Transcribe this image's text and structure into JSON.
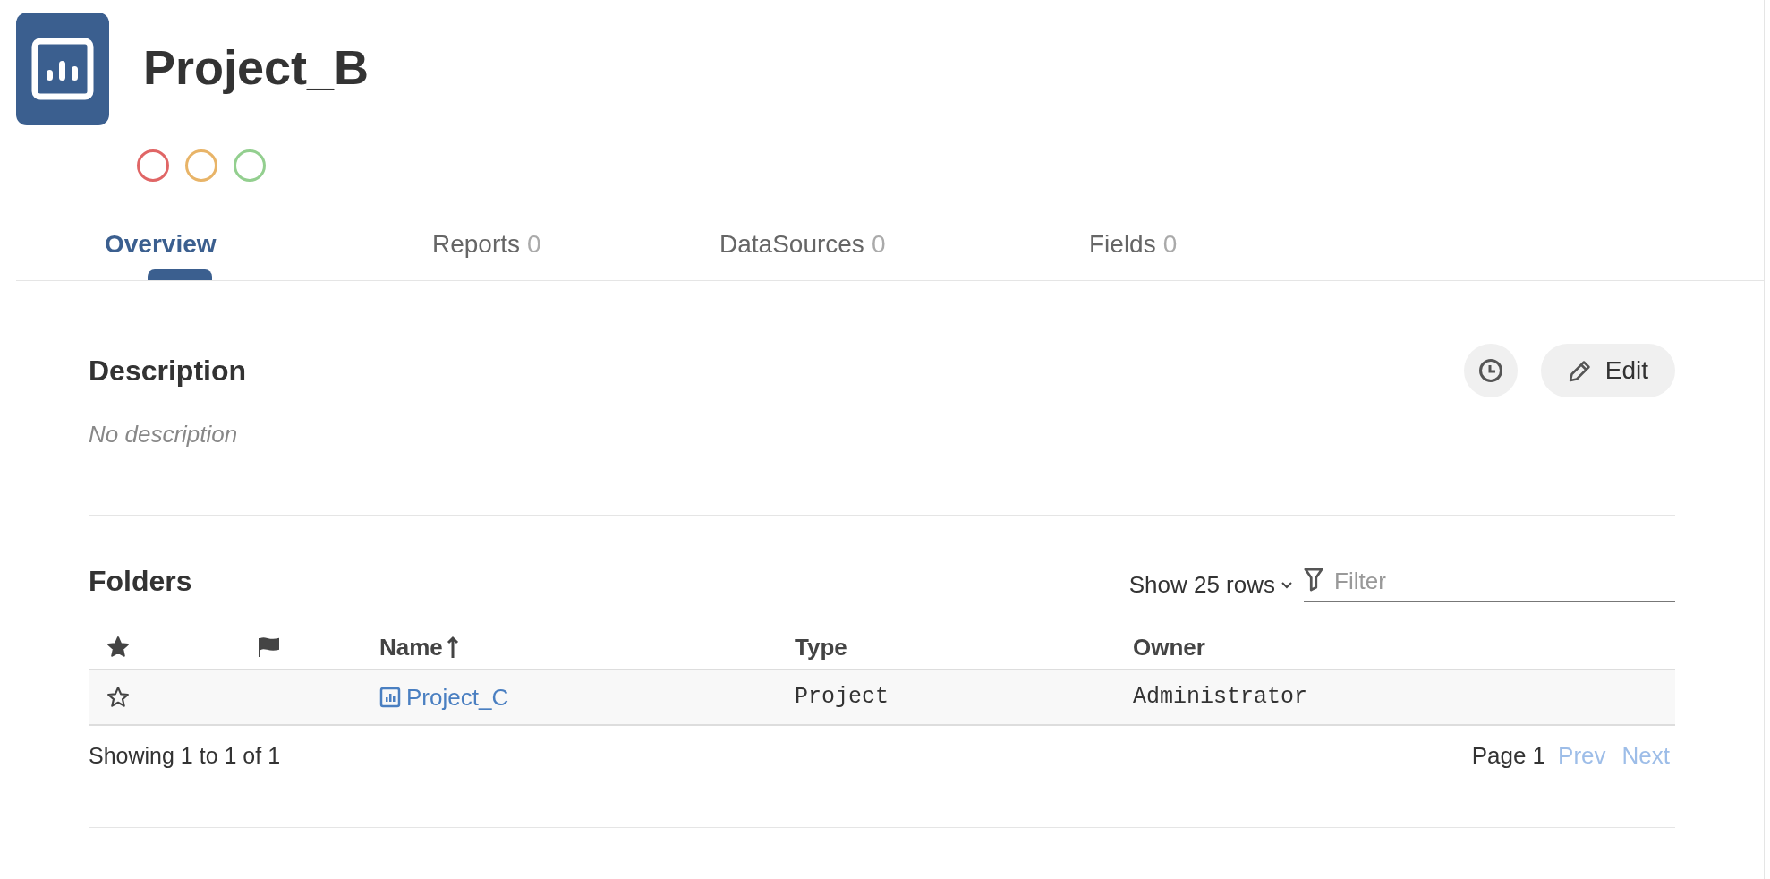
{
  "header": {
    "title": "Project_B",
    "status_circles": [
      {
        "color": "#e06666"
      },
      {
        "color": "#e8b468"
      },
      {
        "color": "#93cf8f"
      }
    ]
  },
  "tabs": [
    {
      "label": "Overview",
      "selected": true
    },
    {
      "label": "Reports",
      "count": "0",
      "selected": false
    },
    {
      "label": "DataSources",
      "count": "0",
      "selected": false
    },
    {
      "label": "Fields",
      "count": "0",
      "selected": false
    }
  ],
  "description": {
    "heading": "Description",
    "text": "No description",
    "edit_button": "Edit"
  },
  "folders": {
    "heading": "Folders",
    "rows_selector": "Show 25 rows",
    "filter": {
      "placeholder": "Filter"
    },
    "columns": [
      {
        "kind": "star"
      },
      {
        "kind": "flag"
      },
      {
        "kind": "text",
        "label": "Name",
        "sorted": true
      },
      {
        "kind": "text",
        "label": "Type",
        "sorted": false
      },
      {
        "kind": "text",
        "label": "Owner",
        "sorted": false
      }
    ],
    "rows": [
      {
        "starred": false,
        "name": "Project_C",
        "type": "Project",
        "owner": "Administrator"
      }
    ],
    "summary": "Showing 1 to 1 of 1",
    "page": "Page 1",
    "prev": "Prev",
    "next": "Next"
  }
}
